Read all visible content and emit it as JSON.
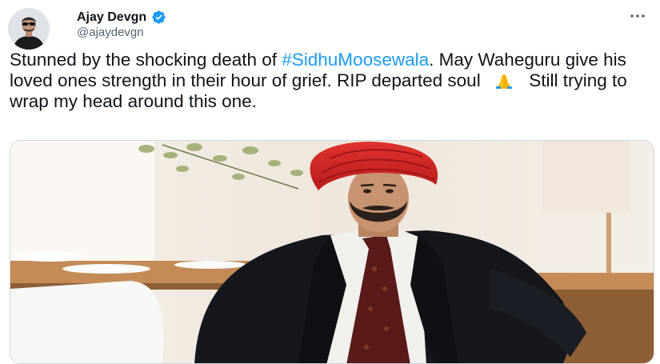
{
  "tweet": {
    "author": {
      "display_name": "Ajay Devgn",
      "handle": "@ajaydevgn",
      "verified": true
    },
    "text": {
      "part1": "Stunned by the shocking death of ",
      "hashtag": "#SidhuMoosewala",
      "part2": ". May Waheguru give his loved ones strength in their hour of grief.  RIP departed soul ",
      "part3": " Still trying to wrap my head around this one."
    },
    "icons": {
      "more": "more-horizontal-icon",
      "verified": "verified-badge-icon",
      "emoji": "folded-hands-emoji"
    },
    "colors": {
      "link": "#1d9bf0",
      "verified": "#1d9bf0",
      "text": "#0f1419",
      "secondary": "#536471"
    },
    "media": {
      "type": "photo"
    }
  }
}
